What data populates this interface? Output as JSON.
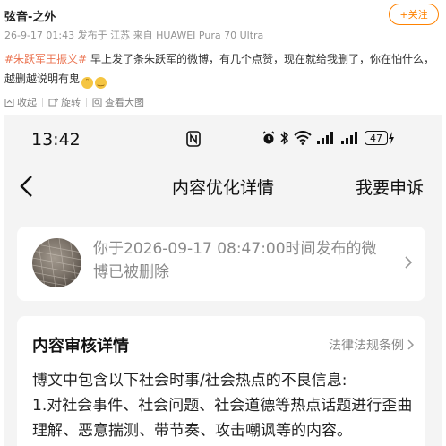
{
  "post": {
    "author": "弦音-之外",
    "meta": "26-9-17 01:43 发布于 江苏 来自 HUAWEI Pura 70 Ultra",
    "follow_label": "+关注",
    "hashtag": "#朱跃军王振义#",
    "text": " 早上发了条朱跃军的微博，有几个点赞，现在就给我删了，你在怕什么，越删越说明有鬼",
    "actions": {
      "collapse": "收起",
      "rotate": "旋转",
      "view_large": "查看大图"
    }
  },
  "phone": {
    "time": "13:42",
    "battery": "47",
    "nav_title": "内容优化详情",
    "appeal": "我要申诉",
    "notice": "你于2026-09-17 08:47:00时间发布的微博已被删除",
    "review_title": "内容审核详情",
    "law_link": "法律法规条例",
    "review_body": "博文中包含以下社会时事/社会热点的不良信息:\n1.对社会事件、社会问题、社会道德等热点话题进行歪曲理解、恶意揣测、带节奏、攻击嘲讽等的内容。"
  },
  "colors": {
    "accent": "#ff8200",
    "hashtag": "#eb7350"
  }
}
